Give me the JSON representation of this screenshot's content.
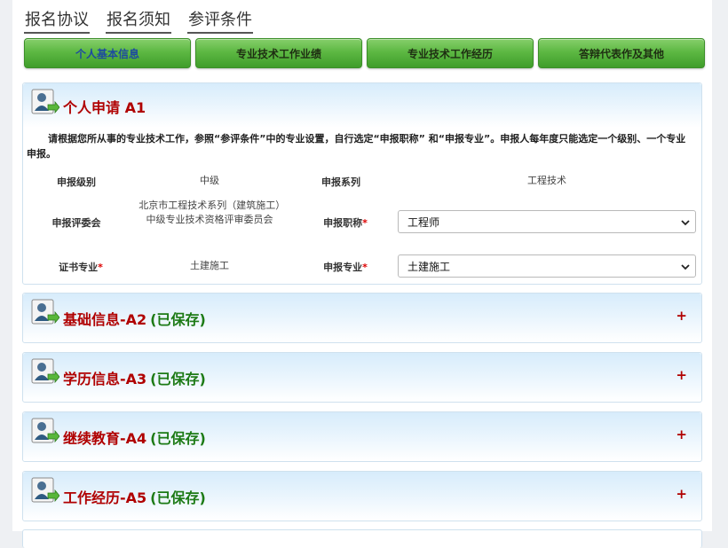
{
  "top_links": [
    "报名协议",
    "报名须知",
    "参评条件"
  ],
  "tabs": [
    "个人基本信息",
    "专业技术工作业绩",
    "专业技术工作经历",
    "答辩代表作及其他"
  ],
  "panel_a1": {
    "title": "个人申请 A1",
    "intro": "请根据您所从事的专业技术工作，参照“参评条件”中的专业设置，自行选定“申报职称” 和“申报专业”。申报人每年度只能选定一个级别、一个专业申报。",
    "fields": {
      "level_label": "申报级别",
      "level_value": "中级",
      "series_label": "申报系列",
      "series_value": "工程技术",
      "committee_label": "申报评委会",
      "committee_value": "北京市工程技术系列（建筑施工）中级专业技术资格评审委员会",
      "title_label": "申报职称",
      "title_value": "工程师",
      "cert_major_label": "证书专业",
      "cert_major_value": "土建施工",
      "major_label": "申报专业",
      "major_value": "土建施工",
      "required_mark": "*"
    }
  },
  "collapsed_panels": [
    {
      "title": "基础信息-A2",
      "status": "(已保存)"
    },
    {
      "title": "学历信息-A3",
      "status": "(已保存)"
    },
    {
      "title": "继续教育-A4",
      "status": "(已保存)"
    },
    {
      "title": "工作经历-A5",
      "status": "(已保存)"
    }
  ],
  "expand_symbol": "+",
  "icons": {
    "panel": "user-form-icon",
    "select": "chevron-down-icon"
  },
  "colors": {
    "title_red": "#b00000",
    "saved_green": "#1c7a15",
    "tab_green": "#5db843",
    "active_tab_text": "#1d4aa0"
  }
}
